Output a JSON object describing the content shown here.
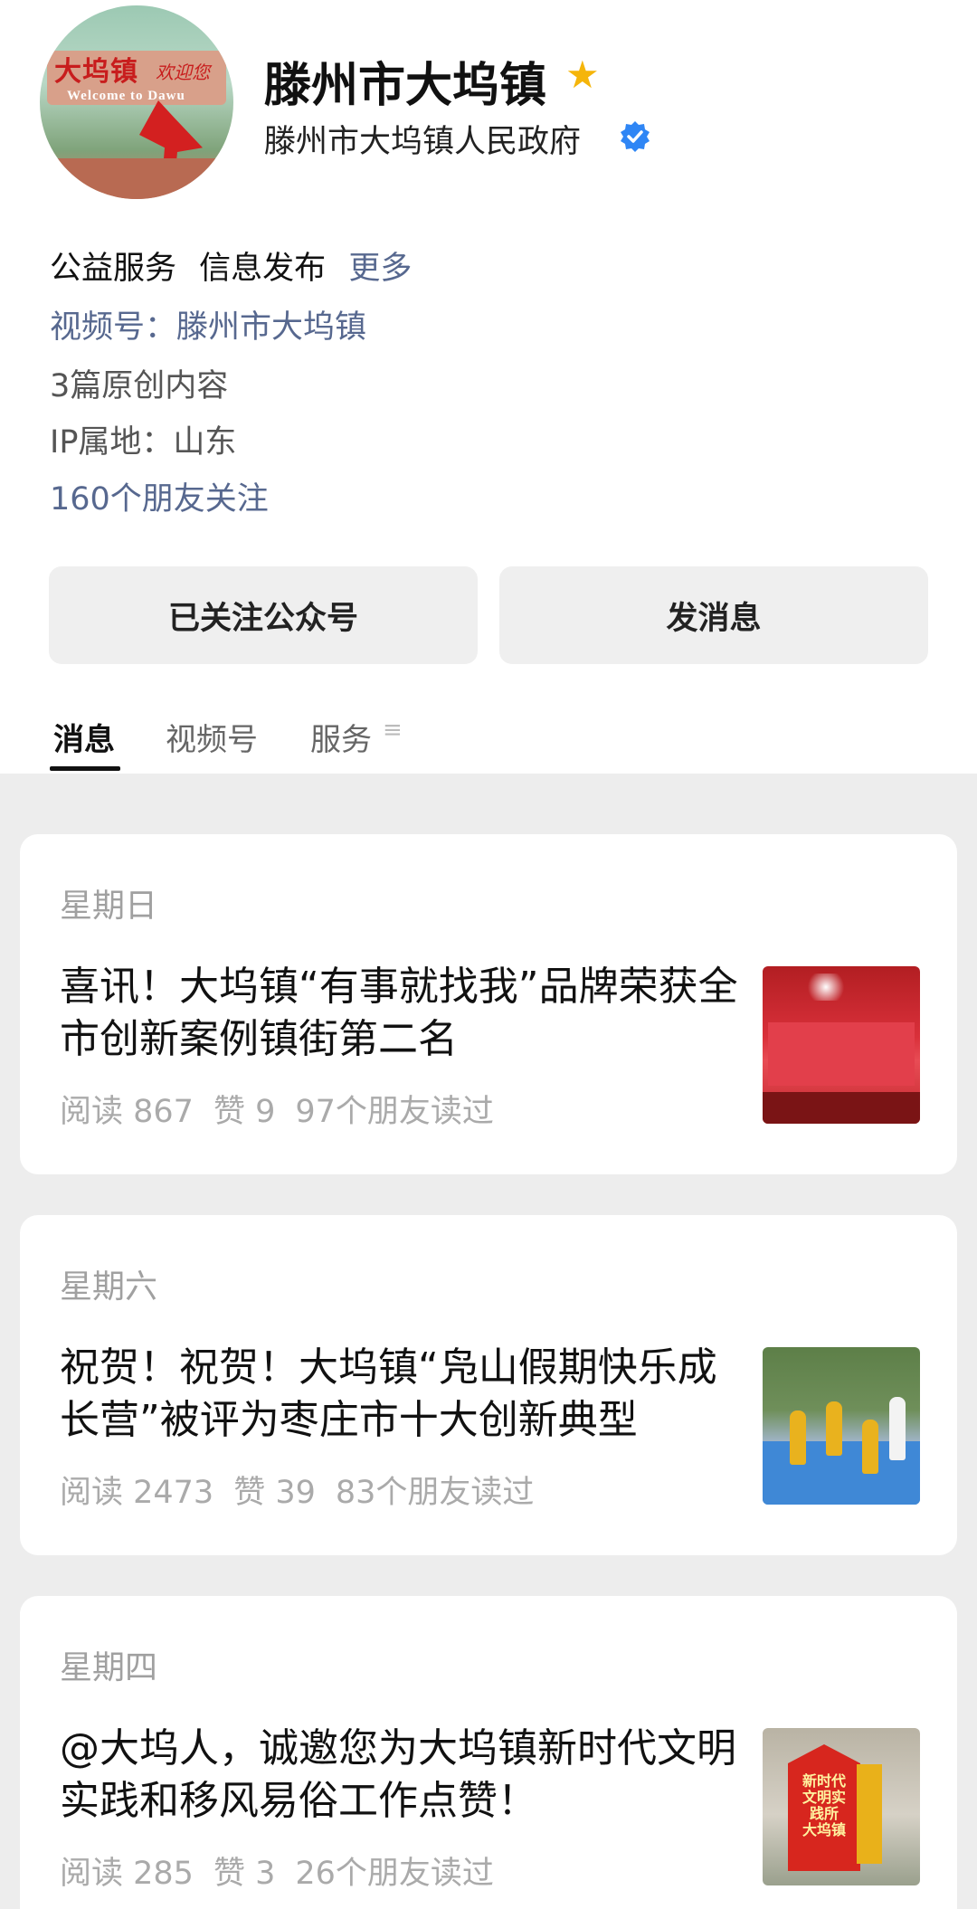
{
  "profile": {
    "avatar_text": "大坞镇 欢迎您",
    "avatar_subtext": "Welcome to Dawu",
    "name": "滕州市大坞镇",
    "org": "滕州市大坞镇人民政府",
    "star_icon": "star-icon",
    "verified_icon": "verified-badge-icon"
  },
  "tags": {
    "tag1": "公益服务",
    "tag2": "信息发布",
    "more": "更多"
  },
  "video_channel": "视频号：滕州市大坞镇",
  "original_count": "3篇原创内容",
  "ip_location": "IP属地：山东",
  "friends_following": "160个朋友关注",
  "buttons": {
    "follow": "已关注公众号",
    "message": "发消息"
  },
  "tabs": {
    "messages": "消息",
    "video": "视频号",
    "service": "服务",
    "menu_icon": "≡"
  },
  "articles": [
    {
      "day": "星期日",
      "title": "喜讯！大坞镇“有事就找我”品牌荣获全市创新案例镇街第二名",
      "reads": "阅读 867",
      "likes": "赞 9",
      "friends_read": "97个朋友读过"
    },
    {
      "day": "星期六",
      "title": "祝贺！祝贺！大坞镇“凫山假期快乐成长营”被评为枣庄市十大创新典型",
      "reads": "阅读 2473",
      "likes": "赞 39",
      "friends_read": "83个朋友读过"
    },
    {
      "day": "星期四",
      "title": "@大坞人，诚邀您为大坞镇新时代文明实践和移风易俗工作点赞！",
      "reads": "阅读 285",
      "likes": "赞 3",
      "friends_read": "26个朋友读过"
    }
  ],
  "thumb3_sign_text": "新时代 文明实践所 大坞镇",
  "colors": {
    "link": "#57688f",
    "star": "#f5b50a",
    "verified": "#2f86f5",
    "feed_bg": "#ededed"
  }
}
